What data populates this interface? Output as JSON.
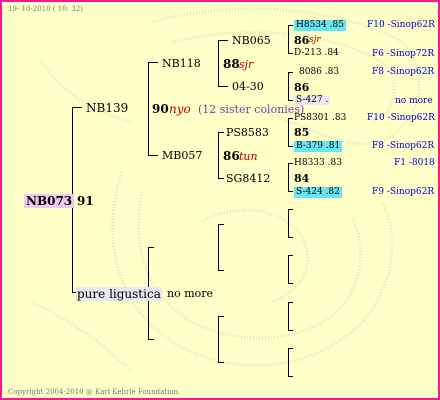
{
  "header": {
    "timestamp": "19- 10-2010 ( 10: 32)"
  },
  "footer": {
    "copyright": "Copyright 2004-2010 @ Karl Kehrle Foundation."
  },
  "root": {
    "id": "NB073",
    "year": "91"
  },
  "sire": {
    "id": "NB139"
  },
  "dam": {
    "label": "pure ligustica",
    "note": "no more"
  },
  "sire_sire": {
    "id": "NB118"
  },
  "sire_dam": {
    "id": "MB057"
  },
  "sire_year": "90",
  "sire_type": "nyo",
  "sisters": "(12 sister colonies)",
  "gen3": {
    "nb118_year": "88",
    "nb118_type": "sjr",
    "mb057_year": "86",
    "mb057_type": "tun"
  },
  "gen4": {
    "a": "NB065",
    "b": "04-30",
    "c": "PS8583",
    "d": "SG8412"
  },
  "gen5": {
    "r1_id": "H8534 .85",
    "r1_src": "F10 -Sinop62R",
    "r2_year": "86",
    "r2_type": "sjr",
    "r3_id": "D-213 .84",
    "r3_src": "F6 -Sinop72R",
    "r4_id": "8086 .83",
    "r4_src": "F8 -Sinop62R",
    "r5_year": "86",
    "r6_id": "S-427 .",
    "r6_src": "no more",
    "r7_id": "PS8301 .83",
    "r7_src": "F10 -Sinop62R",
    "r8_year": "85",
    "r9_id": "B-379 .81",
    "r9_src": "F8 -Sinop62R",
    "r10_id": "H8333 .83",
    "r10_src": "F1 -8018",
    "r11_year": "84",
    "r12_id": "S-424 .82",
    "r12_src": "F9 -Sinop62R"
  },
  "colors": {
    "border": "#ff1493",
    "background": "#ffffc8",
    "highlight": "#66e6f2",
    "link": "#0000cc"
  }
}
